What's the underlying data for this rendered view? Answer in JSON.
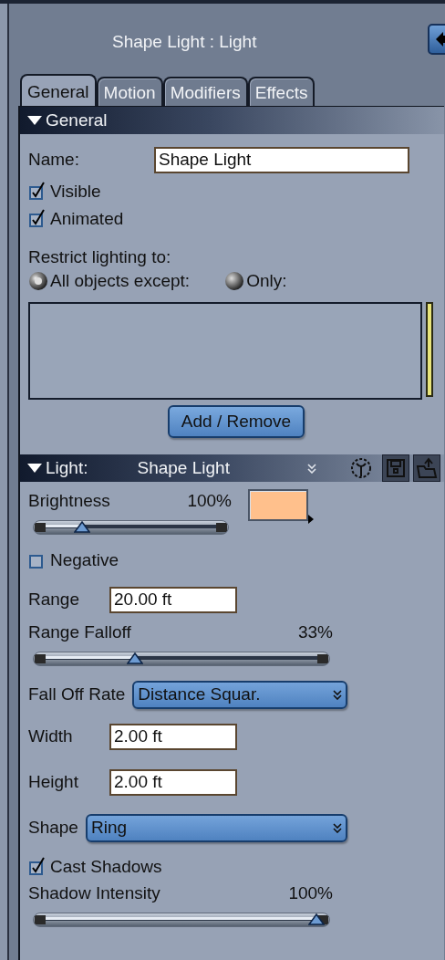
{
  "window": {
    "title": "Shape Light : Light"
  },
  "tabs": [
    {
      "label": "General",
      "selected": true
    },
    {
      "label": "Motion",
      "selected": false
    },
    {
      "label": "Modifiers",
      "selected": false
    },
    {
      "label": "Effects",
      "selected": false
    }
  ],
  "general": {
    "header": "General",
    "expanded": true,
    "name_label": "Name:",
    "name_value": "Shape Light",
    "checkboxes": [
      {
        "label": "Visible",
        "checked": true
      },
      {
        "label": "Animated",
        "checked": true
      }
    ],
    "restrict_label": "Restrict lighting to:",
    "radios": [
      {
        "label": "All objects except:",
        "selected": true
      },
      {
        "label": "Only:",
        "selected": false
      }
    ],
    "button": "Add / Remove"
  },
  "light": {
    "header_label": "Light:",
    "header_value": "Shape Light",
    "expanded": true,
    "rows": [
      {
        "kind": "slider",
        "label": "Brightness",
        "reading": "100%",
        "level": 0.22,
        "color": "#ffc08c"
      },
      {
        "kind": "checkbox",
        "label": "Negative",
        "checked": false
      },
      {
        "kind": "field",
        "label": "Range",
        "value": "20.00 ft"
      },
      {
        "kind": "slider",
        "label": "Range Falloff",
        "reading": "33%",
        "level": 0.33
      },
      {
        "kind": "dropdown",
        "label": "Fall Off Rate",
        "value": "Distance Squar."
      },
      {
        "kind": "field",
        "label": "Width",
        "value": "2.00 ft"
      },
      {
        "kind": "field",
        "label": "Height",
        "value": "2.00 ft"
      },
      {
        "kind": "dropdown",
        "label": "Shape",
        "value": "Ring"
      },
      {
        "kind": "checkbox",
        "label": "Cast Shadows",
        "checked": true
      },
      {
        "kind": "slider",
        "label": "Shadow Intensity",
        "reading": "100%",
        "level": 0.98
      }
    ]
  }
}
